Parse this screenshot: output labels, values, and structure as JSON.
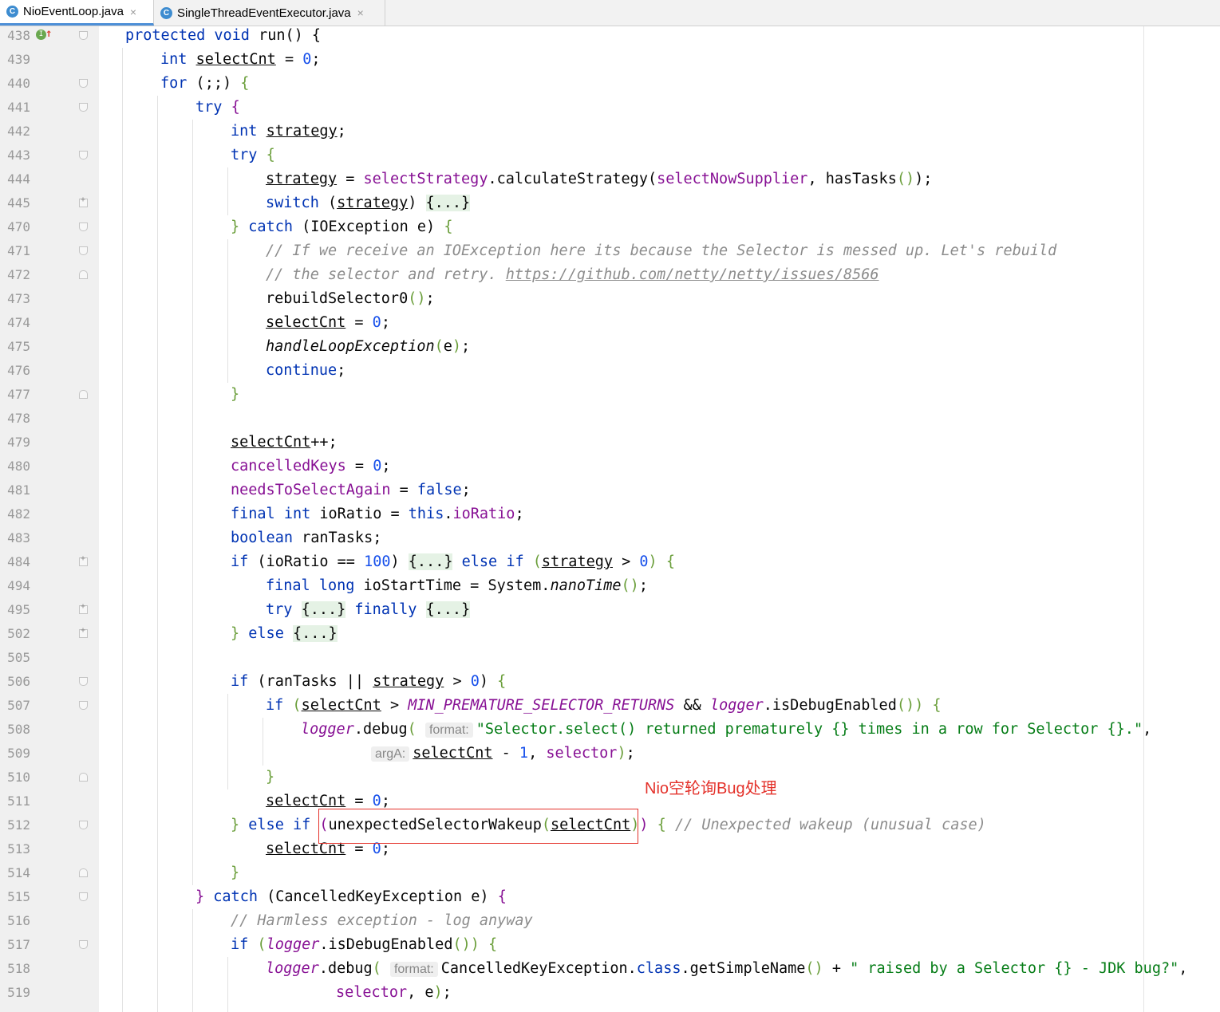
{
  "tabs": [
    {
      "label": "NioEventLoop.java",
      "icon": "class-icon",
      "active": true
    },
    {
      "label": "SingleThreadEventExecutor.java",
      "icon": "class-icon",
      "active": false
    }
  ],
  "annotation": "Nio空轮询Bug处理",
  "lines": [
    {
      "n": "438",
      "fold": "open",
      "ind": 0,
      "html": "<span class=\"kw\">protected void</span> run() {"
    },
    {
      "n": "439",
      "fold": "",
      "ind": 1,
      "html": "<span class=\"kw\">int</span> <span class=\"ul\">selectCnt</span> = <span class=\"num\">0</span>;"
    },
    {
      "n": "440",
      "fold": "open",
      "ind": 1,
      "html": "<span class=\"kw\">for</span> (;;) <span class=\"br\">{</span>"
    },
    {
      "n": "441",
      "fold": "open",
      "ind": 2,
      "html": "<span class=\"kw\">try</span> <span class=\"fld\">{</span>"
    },
    {
      "n": "442",
      "fold": "",
      "ind": 3,
      "html": "<span class=\"kw\">int</span> <span class=\"ul\">strategy</span>;"
    },
    {
      "n": "443",
      "fold": "open",
      "ind": 3,
      "html": "<span class=\"kw\">try</span> <span class=\"br\">{</span>"
    },
    {
      "n": "444",
      "fold": "",
      "ind": 4,
      "html": "<span class=\"ul\">strategy</span> = <span class=\"fld\">selectStrategy</span>.calculateStrategy(<span class=\"fld\">selectNowSupplier</span>, hasTasks<span class=\"br\">()</span>);"
    },
    {
      "n": "445",
      "fold": "plus",
      "ind": 4,
      "html": "<span class=\"kw\">switch</span> (<span class=\"ul\">strategy</span>) <span class=\"fc\">{...}</span>"
    },
    {
      "n": "470",
      "fold": "open",
      "ind": 3,
      "html": "<span class=\"br\">}</span> <span class=\"kw\">catch</span> (IOException e) <span class=\"br\">{</span>"
    },
    {
      "n": "471",
      "fold": "open",
      "ind": 4,
      "html": "<span class=\"cmt\">// If we receive an IOException here its because the Selector is messed up. Let's rebuild</span>"
    },
    {
      "n": "472",
      "fold": "close",
      "ind": 4,
      "html": "<span class=\"cmt\">// the selector and retry. <span class=\"lnk\">https://github.com/netty/netty/issues/8566</span></span>"
    },
    {
      "n": "473",
      "fold": "",
      "ind": 4,
      "html": "rebuildSelector0<span class=\"br\">()</span>;"
    },
    {
      "n": "474",
      "fold": "",
      "ind": 4,
      "html": "<span class=\"ul\">selectCnt</span> = <span class=\"num\">0</span>;"
    },
    {
      "n": "475",
      "fold": "",
      "ind": 4,
      "html": "<span class=\"it\">handleLoopException</span><span class=\"br\">(</span>e<span class=\"br\">)</span>;"
    },
    {
      "n": "476",
      "fold": "",
      "ind": 4,
      "html": "<span class=\"kw\">continue</span>;"
    },
    {
      "n": "477",
      "fold": "close",
      "ind": 3,
      "html": "<span class=\"br\">}</span>"
    },
    {
      "n": "478",
      "fold": "",
      "ind": 3,
      "html": ""
    },
    {
      "n": "479",
      "fold": "",
      "ind": 3,
      "html": "<span class=\"ul\">selectCnt</span>++;"
    },
    {
      "n": "480",
      "fold": "",
      "ind": 3,
      "html": "<span class=\"fld\">cancelledKeys</span> = <span class=\"num\">0</span>;"
    },
    {
      "n": "481",
      "fold": "",
      "ind": 3,
      "html": "<span class=\"fld\">needsToSelectAgain</span> = <span class=\"kw\">false</span>;"
    },
    {
      "n": "482",
      "fold": "",
      "ind": 3,
      "html": "<span class=\"kw\">final int</span> ioRatio = <span class=\"kw\">this</span>.<span class=\"fld\">ioRatio</span>;"
    },
    {
      "n": "483",
      "fold": "",
      "ind": 3,
      "html": "<span class=\"kw\">boolean</span> ranTasks;"
    },
    {
      "n": "484",
      "fold": "plus",
      "ind": 3,
      "html": "<span class=\"kw\">if</span> (ioRatio == <span class=\"num\">100</span>) <span class=\"fc\">{...}</span> <span class=\"kw\">else if</span> <span class=\"br\">(</span><span class=\"ul\">strategy</span> &gt; <span class=\"num\">0</span><span class=\"br\">)</span> <span class=\"br\">{</span>"
    },
    {
      "n": "494",
      "fold": "",
      "ind": 4,
      "html": "<span class=\"kw\">final long</span> ioStartTime = System.<span class=\"it\">nanoTime</span><span class=\"br\">()</span>;"
    },
    {
      "n": "495",
      "fold": "plus",
      "ind": 4,
      "html": "<span class=\"kw\">try</span> <span class=\"fc\">{...}</span> <span class=\"kw\">finally</span> <span class=\"fc\">{...}</span>"
    },
    {
      "n": "502",
      "fold": "plus",
      "ind": 3,
      "html": "<span class=\"br\">}</span> <span class=\"kw\">else</span> <span class=\"fc\">{...}</span>"
    },
    {
      "n": "505",
      "fold": "",
      "ind": 3,
      "html": ""
    },
    {
      "n": "506",
      "fold": "open",
      "ind": 3,
      "html": "<span class=\"kw\">if</span> (ranTasks || <span class=\"ul\">strategy</span> &gt; <span class=\"num\">0</span>) <span class=\"br\">{</span>"
    },
    {
      "n": "507",
      "fold": "open",
      "ind": 4,
      "html": "<span class=\"kw\">if</span> <span class=\"br\">(</span><span class=\"ul\">selectCnt</span> &gt; <span class=\"fld it\">MIN_PREMATURE_SELECTOR_RETURNS</span> &amp;&amp; <span class=\"fld it\">logger</span>.isDebugEnabled<span class=\"br\">()</span><span class=\"br\">)</span> <span class=\"br\">{</span>"
    },
    {
      "n": "508",
      "fold": "",
      "ind": 5,
      "html": "<span class=\"fld it\">logger</span>.debug<span class=\"br\">(</span> <span class=\"hint\">format:</span><span class=\"str\">\"Selector.select() returned prematurely {} times in a row for Selector {}.\"</span>,"
    },
    {
      "n": "509",
      "fold": "",
      "ind": 7,
      "html": "<span class=\"hint\">argA:</span><span class=\"ul\">selectCnt</span> - <span class=\"num\">1</span>, <span class=\"fld\">selector</span><span class=\"br\">)</span>;"
    },
    {
      "n": "510",
      "fold": "close",
      "ind": 4,
      "html": "<span class=\"br\">}</span>"
    },
    {
      "n": "511",
      "fold": "",
      "ind": 4,
      "html": "<span class=\"ul\">selectCnt</span> = <span class=\"num\">0</span>;"
    },
    {
      "n": "512",
      "fold": "open",
      "ind": 3,
      "html": "<span class=\"br\">}</span> <span class=\"kw\">else if</span> <span class=\"fld\">(</span>unexpectedSelectorWakeup<span class=\"br\">(</span><span class=\"ul\">selectCnt</span><span class=\"br\">)</span><span class=\"fld\">)</span> <span class=\"br\">{</span> <span class=\"cmt\">// Unexpected wakeup (unusual case)</span>"
    },
    {
      "n": "513",
      "fold": "",
      "ind": 4,
      "html": "<span class=\"ul\">selectCnt</span> = <span class=\"num\">0</span>;"
    },
    {
      "n": "514",
      "fold": "close",
      "ind": 3,
      "html": "<span class=\"br\">}</span>"
    },
    {
      "n": "515",
      "fold": "open",
      "ind": 2,
      "html": "<span class=\"fld\">}</span> <span class=\"kw\">catch</span> (CancelledKeyException e) <span class=\"fld\">{</span>"
    },
    {
      "n": "516",
      "fold": "",
      "ind": 3,
      "html": "<span class=\"cmt\">// Harmless exception - log anyway</span>"
    },
    {
      "n": "517",
      "fold": "open",
      "ind": 3,
      "html": "<span class=\"kw\">if</span> <span class=\"br\">(</span><span class=\"fld it\">logger</span>.isDebugEnabled<span class=\"br\">()</span><span class=\"br\">)</span> <span class=\"br\">{</span>"
    },
    {
      "n": "518",
      "fold": "",
      "ind": 4,
      "html": "<span class=\"fld it\">logger</span>.debug<span class=\"br\">(</span> <span class=\"hint\">format:</span>CancelledKeyException.<span class=\"kw\">class</span>.getSimpleName<span class=\"br\">()</span> + <span class=\"str\">\" raised by a Selector {} - JDK bug?\"</span>,"
    },
    {
      "n": "519",
      "fold": "",
      "ind": 6,
      "html": "<span class=\"fld\">selector</span>, e<span class=\"br\">)</span>;"
    }
  ]
}
